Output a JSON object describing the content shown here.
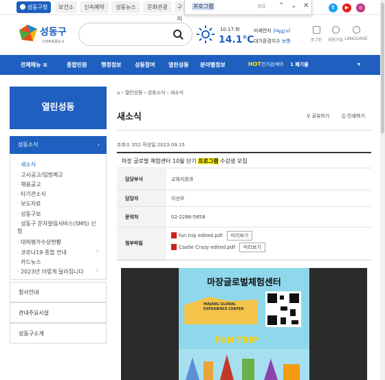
{
  "top_tabs": [
    {
      "label": "성동구청"
    },
    {
      "label": "보건소"
    },
    {
      "label": "신속예약"
    },
    {
      "label": "성동뉴스"
    },
    {
      "label": "문화관광"
    },
    {
      "label": "구의"
    }
  ],
  "find": {
    "query": "프로그램",
    "count": "0/1"
  },
  "social": [
    {
      "icon": "b",
      "color": "#3cb44b"
    },
    {
      "icon": "t",
      "color": "#1da1f2"
    },
    {
      "icon": "y",
      "color": "#e62117"
    },
    {
      "icon": "i",
      "color": "#c13584"
    }
  ],
  "logo": {
    "name": "성동구",
    "tagline": "스마트포용도시"
  },
  "weather": {
    "date": "10.17.화",
    "temp": "14.1℃",
    "dust_label": "미세먼지",
    "dust_value": "34㎍/㎥",
    "air_label": "대기환경지수",
    "air_value": "보통"
  },
  "util": [
    {
      "label": "로그인"
    },
    {
      "label": "회원가입"
    },
    {
      "label": "LANGUAGE"
    }
  ],
  "nav": {
    "all_menu": "전체메뉴 ≡",
    "items": [
      "종합민원",
      "행정정보",
      "성동참여",
      "열린성동",
      "분야별정보"
    ],
    "hot_label": "HOT",
    "hot_text": "인기검색어",
    "hot_rank": "1 폐기물"
  },
  "sidebar": {
    "title": "열린성동",
    "section": "성동소식",
    "links": [
      "새소식",
      "고시공고/입법예고",
      "채용공고",
      "타기관소식",
      "보도자료",
      "성동구보",
      "성동구 문자알림서비스(SMS) 신청",
      "대외평가수상현황",
      "코로나19 종합 안내",
      "카드뉴스",
      "2023년 이렇게 달라집니다"
    ],
    "items": [
      "청사안내",
      "관내주요시설",
      "성동구소개"
    ]
  },
  "content": {
    "breadcrumb": [
      "열린성동",
      "성동소식",
      "새소식"
    ],
    "title": "새소식",
    "share": "공유하기",
    "print": "인쇄하기",
    "meta": "조회수 352  작성일 2023.09.15",
    "post_title_pre": "마장 글로벌 체험센터 10월 단기 ",
    "post_title_hl": "프로그램",
    "post_title_post": " 수강생 모집",
    "rows": [
      {
        "k": "담당부서",
        "v": "교육지원과"
      },
      {
        "k": "담당자",
        "v": "이선우"
      },
      {
        "k": "문의처",
        "v": "02-2286-5858"
      }
    ],
    "attach_label": "첨부파일",
    "files": [
      {
        "name": "fun trip edited.pdf",
        "btn": "미리보기"
      },
      {
        "name": "Castle Crazy edited.pdf",
        "btn": "미리보기"
      }
    ],
    "poster": {
      "title": "마장글로벌체험센터",
      "sub": "MAJANG GLOBAL EXPERIENCE CENTER",
      "fun": "FUN TRIP"
    }
  }
}
